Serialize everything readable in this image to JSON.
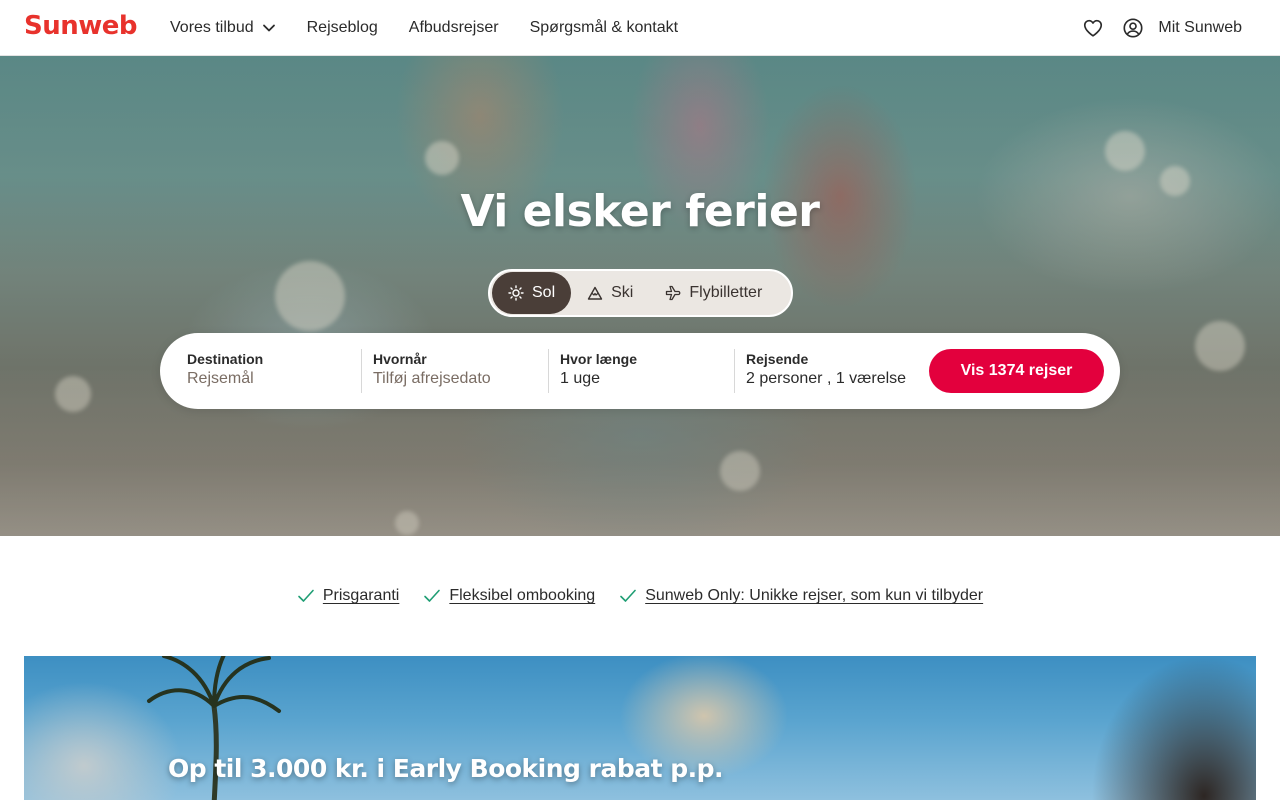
{
  "brand": {
    "logo_text": "Sunweb",
    "accent": "#e8322c",
    "cta_color": "#e3003d"
  },
  "nav": {
    "items": [
      {
        "label": "Vores tilbud",
        "has_dropdown": true
      },
      {
        "label": "Rejseblog"
      },
      {
        "label": "Afbudsrejser"
      },
      {
        "label": "Spørgsmål & kontakt"
      }
    ],
    "account_label": "Mit Sunweb"
  },
  "hero": {
    "title": "Vi elsker ferier",
    "tabs": [
      {
        "label": "Sol",
        "icon": "sun-icon",
        "active": true
      },
      {
        "label": "Ski",
        "icon": "mountain-icon"
      },
      {
        "label": "Flybilletter",
        "icon": "plane-icon"
      }
    ],
    "search": {
      "destination": {
        "label": "Destination",
        "placeholder": "Rejsemål"
      },
      "when": {
        "label": "Hvornår",
        "placeholder": "Tilføj afrejsedato"
      },
      "duration": {
        "label": "Hvor længe",
        "value": "1 uge"
      },
      "travelers": {
        "label": "Rejsende",
        "value": "2 personer , 1 værelse"
      },
      "cta": "Vis 1374 rejser"
    }
  },
  "usps": [
    {
      "label": "Prisgaranti",
      "icon": "check-icon"
    },
    {
      "label": "Fleksibel ombooking",
      "icon": "check-icon"
    },
    {
      "label": "Sunweb Only: Unikke rejser, som kun vi tilbyder",
      "icon": "check-icon"
    }
  ],
  "promo": {
    "title": "Op til 3.000 kr. i Early Booking rabat p.p."
  }
}
